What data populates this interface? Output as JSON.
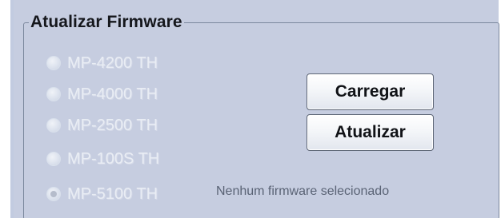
{
  "firmware_panel": {
    "title": "Atualizar Firmware",
    "models": [
      {
        "label": "MP-4200 TH",
        "selected": false
      },
      {
        "label": "MP-4000 TH",
        "selected": false
      },
      {
        "label": "MP-2500 TH",
        "selected": false
      },
      {
        "label": "MP-100S TH",
        "selected": false
      },
      {
        "label": "MP-5100 TH",
        "selected": true
      }
    ],
    "load_button": "Carregar",
    "update_button": "Atualizar",
    "status": "Nenhum firmware selecionado"
  },
  "colors": {
    "panel_background": "#c6cde0",
    "disabled_text": "#e9edf4",
    "border": "#7b879d"
  }
}
